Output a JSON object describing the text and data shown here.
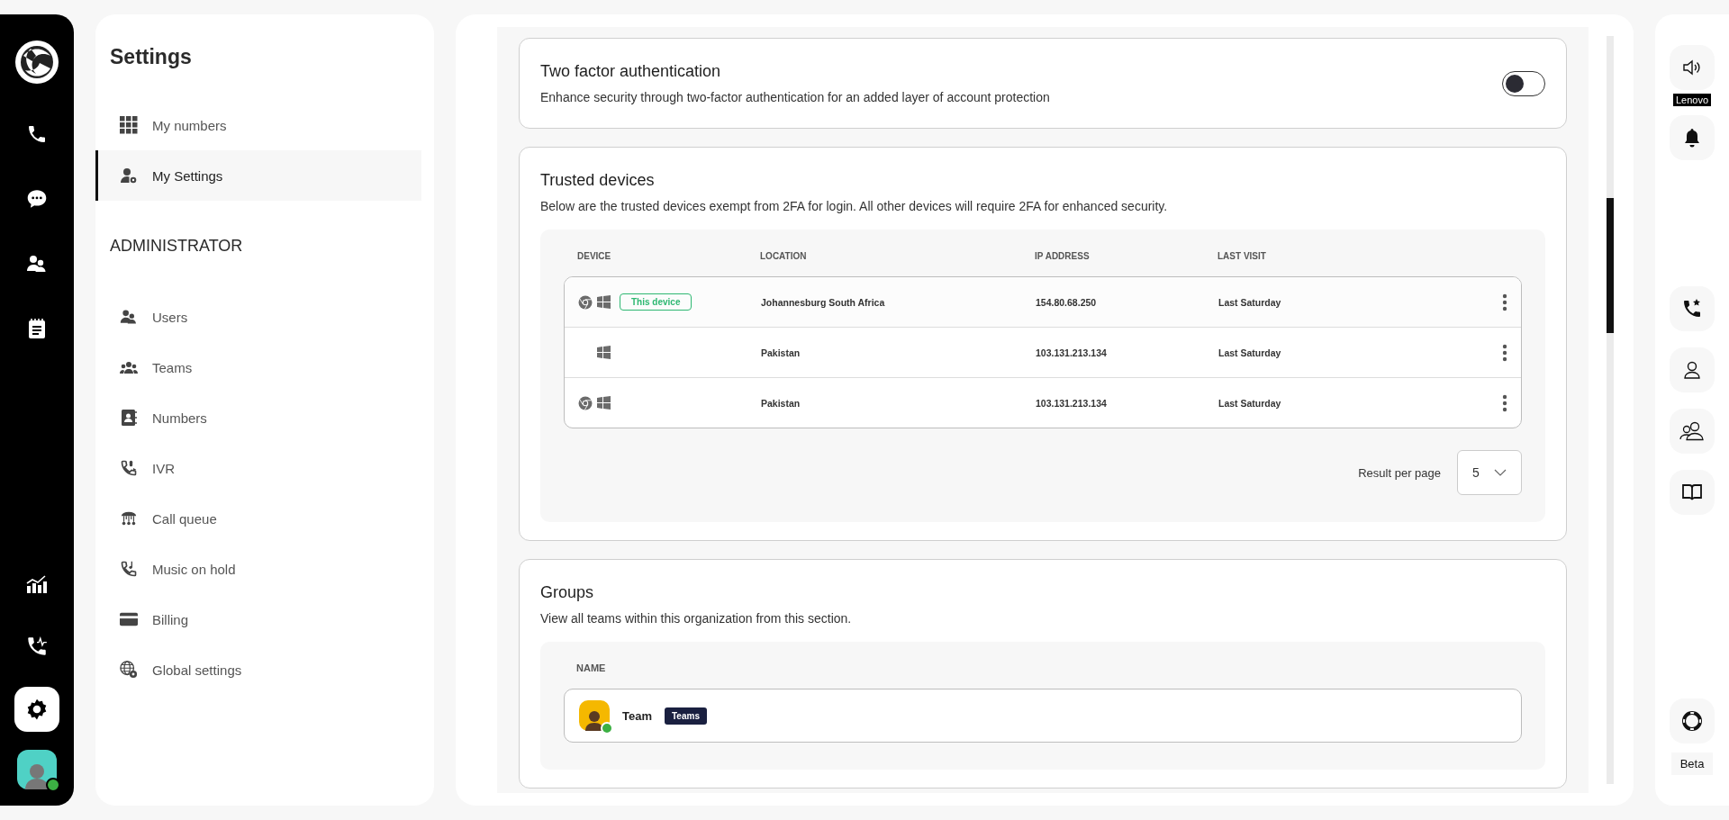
{
  "rail": {
    "items": [
      {
        "selected": false
      },
      {
        "selected": false
      },
      {
        "selected": false
      },
      {
        "selected": false
      },
      {
        "selected": false
      },
      {
        "selected": false
      },
      {
        "selected": true
      }
    ],
    "avatar": {
      "online": true
    }
  },
  "sidebar": {
    "title": "Settings",
    "items": [
      {
        "label": "My numbers",
        "selected": false
      },
      {
        "label": "My Settings",
        "selected": true
      }
    ],
    "section": "ADMINISTRATOR",
    "admin_items": [
      {
        "label": "Users",
        "selected": false
      },
      {
        "label": "Teams",
        "selected": false
      },
      {
        "label": "Numbers",
        "selected": false
      },
      {
        "label": "IVR",
        "selected": false
      },
      {
        "label": "Call queue",
        "selected": false
      },
      {
        "label": "Music on hold",
        "selected": false
      },
      {
        "label": "Billing",
        "selected": false
      },
      {
        "label": "Global settings",
        "selected": false
      }
    ]
  },
  "two_factor": {
    "title": "Two factor authentication",
    "description": "Enhance security through two-factor authentication for an added layer of account protection",
    "on": false
  },
  "trusted_devices": {
    "title": "Trusted devices",
    "description": "Below are the trusted devices exempt from 2FA for login. All other devices will require 2FA for enhanced security.",
    "columns": [
      "DEVICE",
      "LOCATION",
      "IP ADDRESS",
      "LAST VISIT"
    ],
    "rows": [
      {
        "has_browser": true,
        "badge": "This device",
        "location": "Johannesburg South Africa",
        "ip": "154.80.68.250",
        "last_visit": "Last Saturday"
      },
      {
        "has_browser": false,
        "location": "Pakistan",
        "ip": "103.131.213.134",
        "last_visit": "Last Saturday"
      },
      {
        "has_browser": true,
        "location": "Pakistan",
        "ip": "103.131.213.134",
        "last_visit": "Last Saturday"
      }
    ],
    "pagination": {
      "label": "Result per page",
      "value": "5"
    }
  },
  "groups": {
    "title": "Groups",
    "description": "View all teams within this organization from this section.",
    "columns": [
      "NAME"
    ],
    "rows": [
      {
        "name": "Team",
        "tag": "Teams",
        "online": true
      }
    ]
  },
  "right_rail": {
    "device_label": "Lenovo",
    "beta": "Beta"
  }
}
